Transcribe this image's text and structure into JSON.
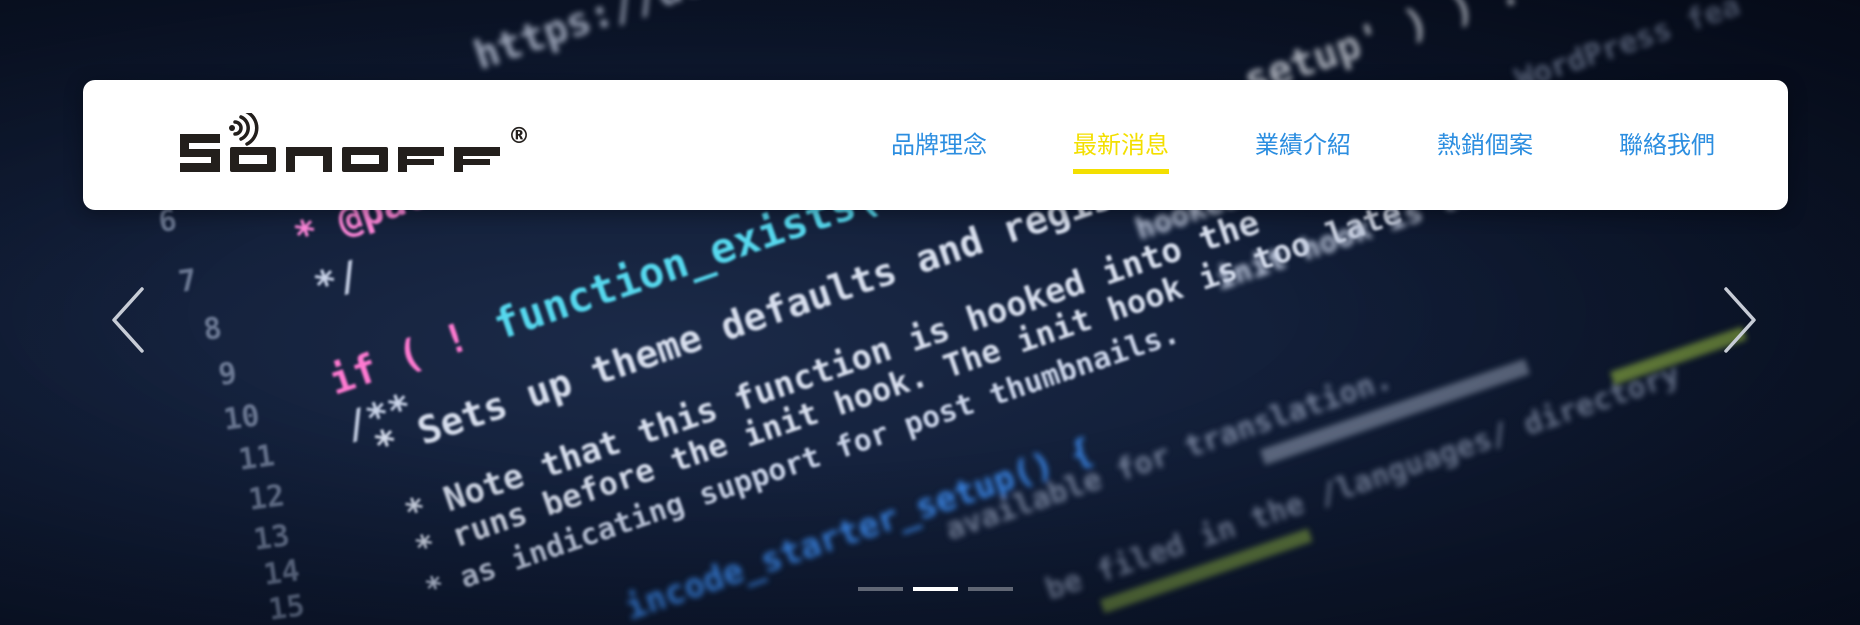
{
  "brand": {
    "logo_text": "SONOFF",
    "registered_mark": "®"
  },
  "nav": {
    "items": [
      {
        "label": "品牌理念",
        "active": false
      },
      {
        "label": "最新消息",
        "active": true
      },
      {
        "label": "業績介紹",
        "active": false
      },
      {
        "label": "熱銷個案",
        "active": false
      },
      {
        "label": "聯絡我們",
        "active": false
      }
    ]
  },
  "colors": {
    "nav_link": "#2c8ee0",
    "nav_active": "#f3df00",
    "navbar_bg": "#ffffff"
  },
  "carousel": {
    "prev_icon": "chevron-left-icon",
    "next_icon": "chevron-right-icon",
    "slide_count": 3,
    "active_slide": 2
  },
  "code_image": {
    "line_numbers": [
      "6",
      "7",
      "8",
      "9",
      "10",
      "11",
      "12",
      "13",
      "14",
      "15"
    ],
    "lines": [
      "https://devel",
      "setup' ) ) :",
      "WordPress fea",
      "* @pack",
      "function_exists(",
      "* Sets up theme defaults and register",
      "*/",
      "hooked into the after",
      "init hook is too late",
      "if ( !",
      "/**",
      "* Sets up theme defaults and registers support for various",
      "* Note that this function is hooked into the",
      "* runs before the init hook. The init hook is too late",
      "* as indicating support for post thumbnails.",
      "incode_starter_setup() {",
      "available for translation.",
      "be filed in the /languages/ directory"
    ]
  }
}
